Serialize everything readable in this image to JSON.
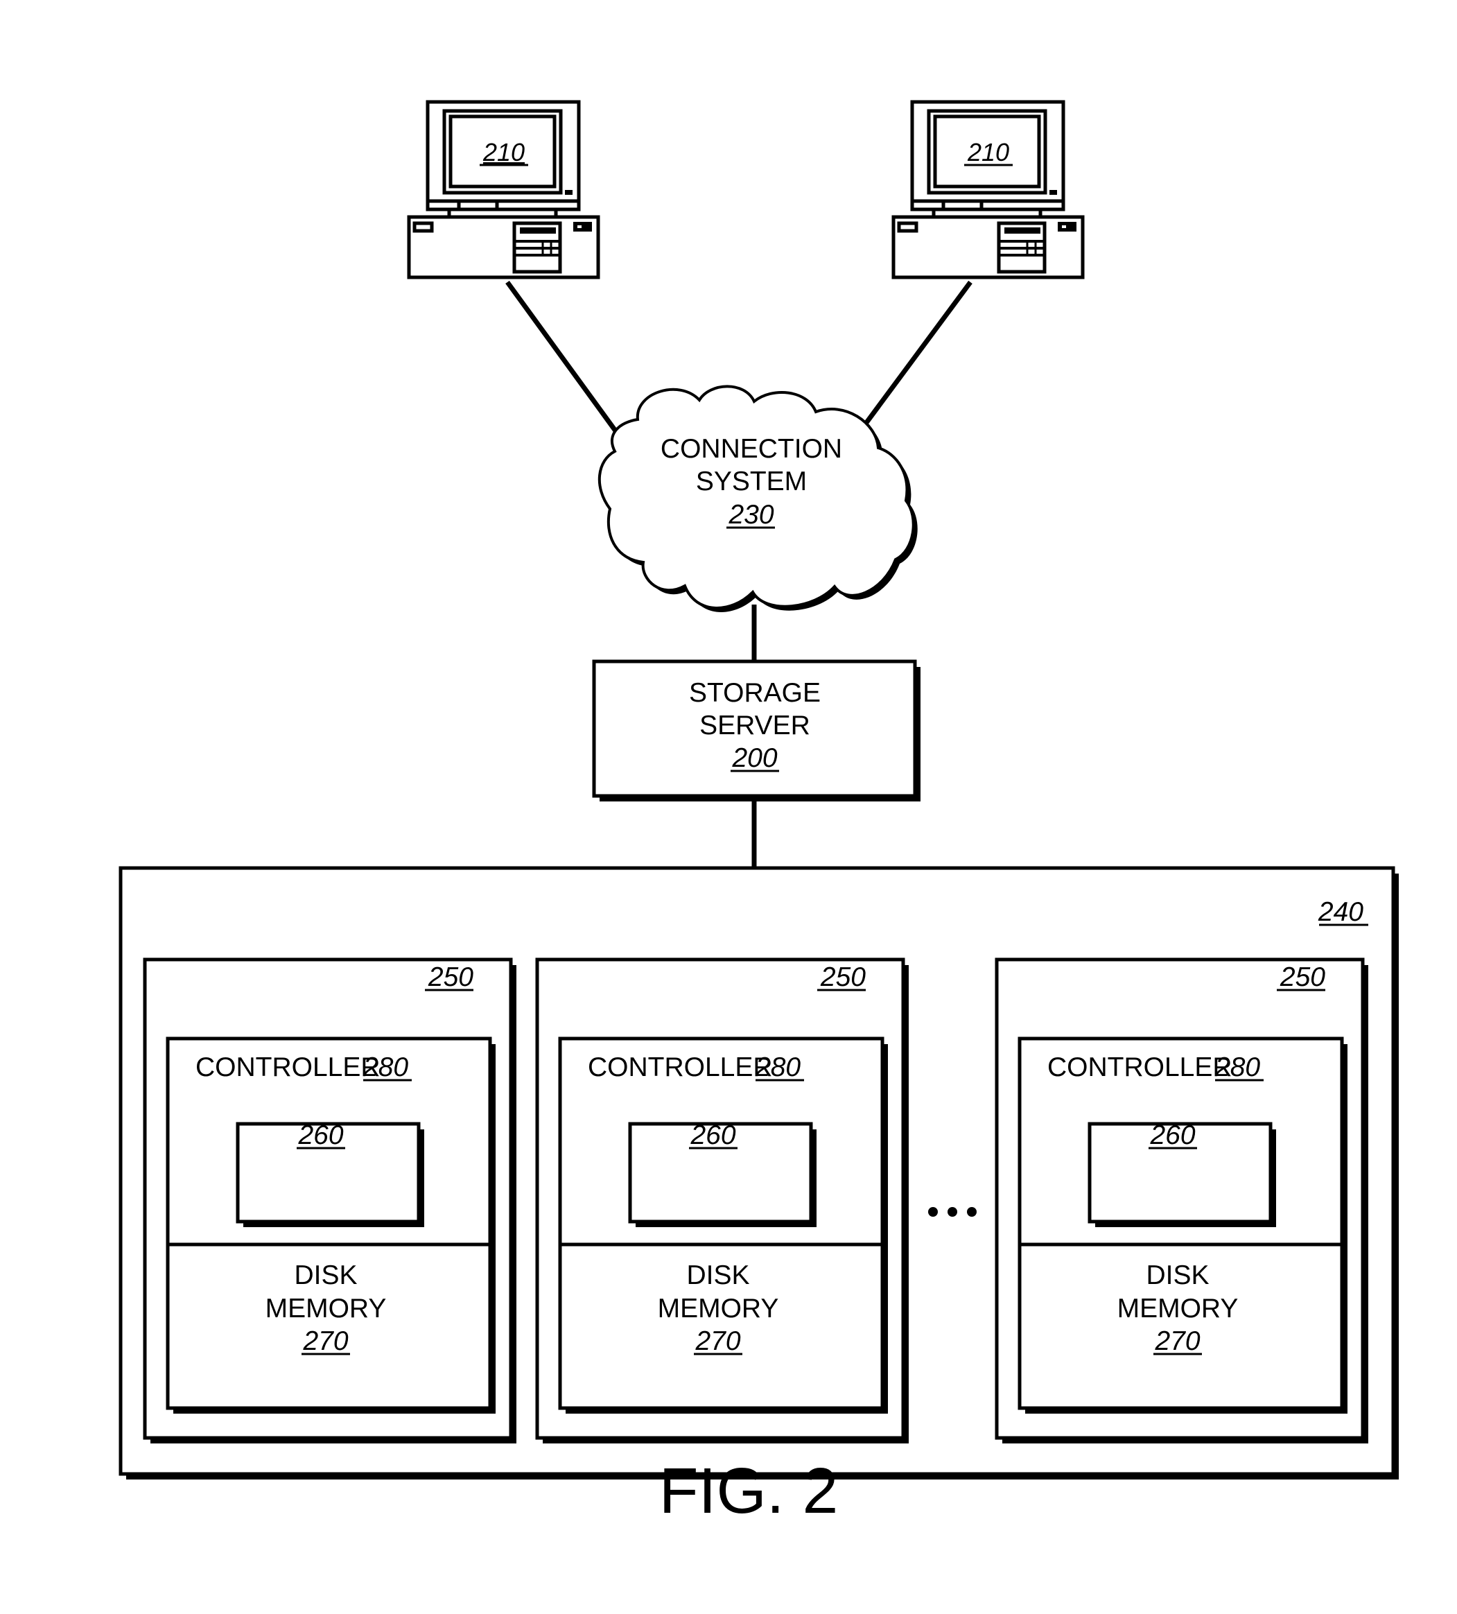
{
  "figure": {
    "caption": "FIG. 2"
  },
  "clients": [
    {
      "ref": "210"
    },
    {
      "ref": "210"
    }
  ],
  "connection_system": {
    "line1": "CONNECTION",
    "line2": "SYSTEM",
    "ref": "230"
  },
  "storage_server": {
    "line1": "STORAGE",
    "line2": "SERVER",
    "ref": "200"
  },
  "storage_subsystem": {
    "ref": "240",
    "ellipsis": "...",
    "units": [
      {
        "ref": "250",
        "controller_label": "CONTROLLER",
        "controller_ref": "280",
        "inner_ref": "260",
        "disk_line1": "DISK",
        "disk_line2": "MEMORY",
        "disk_ref": "270"
      },
      {
        "ref": "250",
        "controller_label": "CONTROLLER",
        "controller_ref": "280",
        "inner_ref": "260",
        "disk_line1": "DISK",
        "disk_line2": "MEMORY",
        "disk_ref": "270"
      },
      {
        "ref": "250",
        "controller_label": "CONTROLLER",
        "controller_ref": "280",
        "inner_ref": "260",
        "disk_line1": "DISK",
        "disk_line2": "MEMORY",
        "disk_ref": "270"
      }
    ]
  }
}
